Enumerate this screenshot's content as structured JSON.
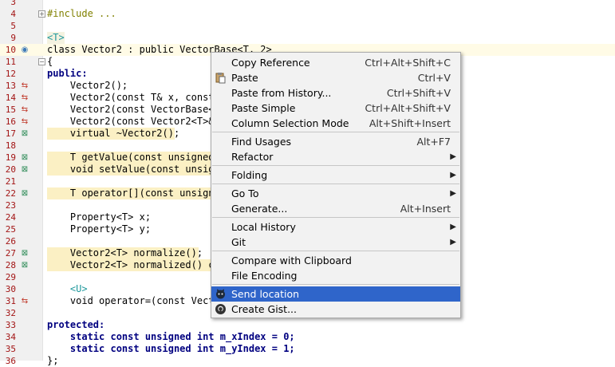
{
  "editor": {
    "lines": [
      {
        "num": "3"
      },
      {
        "num": "4",
        "code": "#include ..."
      },
      {
        "num": "5"
      },
      {
        "num": "9",
        "code": "<T>"
      },
      {
        "num": "10",
        "code": "class Vector2 : public VectorBase<T, 2>"
      },
      {
        "num": "11",
        "code": "{"
      },
      {
        "num": "12",
        "code": "public:"
      },
      {
        "num": "13",
        "code": "    Vector2();"
      },
      {
        "num": "14",
        "code": "    Vector2(const T& x, const"
      },
      {
        "num": "15",
        "code": "    Vector2(const VectorBase<T"
      },
      {
        "num": "16",
        "code": "    Vector2(const Vector2<T>&"
      },
      {
        "num": "17",
        "code": "    virtual ~Vector2();"
      },
      {
        "num": "18"
      },
      {
        "num": "19",
        "code": "    T getValue(const unsigned"
      },
      {
        "num": "20",
        "code": "    void setValue(const unsign"
      },
      {
        "num": "21"
      },
      {
        "num": "22",
        "code": "    T operator[](const unsigne"
      },
      {
        "num": "23"
      },
      {
        "num": "24",
        "code": "    Property<T> x;"
      },
      {
        "num": "25",
        "code": "    Property<T> y;"
      },
      {
        "num": "26"
      },
      {
        "num": "27",
        "code": "    Vector2<T> normalize();"
      },
      {
        "num": "28",
        "code": "    Vector2<T> normalized() co"
      },
      {
        "num": "29"
      },
      {
        "num": "30",
        "code": "    <U>"
      },
      {
        "num": "31",
        "code": "    void operator=(const Vecto"
      },
      {
        "num": "32"
      },
      {
        "num": "33",
        "code": "protected:"
      },
      {
        "num": "34",
        "code": "    static const unsigned int m_xIndex = 0;"
      },
      {
        "num": "35",
        "code": "    static const unsigned int m_yIndex = 1;"
      },
      {
        "num": "36",
        "code": "};"
      }
    ]
  },
  "menu": {
    "items": [
      {
        "label": "Copy Reference",
        "shortcut": "Ctrl+Alt+Shift+C"
      },
      {
        "label": "Paste",
        "shortcut": "Ctrl+V",
        "icon": "clipboard-paste-icon"
      },
      {
        "label": "Paste from History...",
        "shortcut": "Ctrl+Shift+V"
      },
      {
        "label": "Paste Simple",
        "shortcut": "Ctrl+Alt+Shift+V"
      },
      {
        "label": "Column Selection Mode",
        "shortcut": "Alt+Shift+Insert"
      },
      {
        "label": "Find Usages",
        "shortcut": "Alt+F7"
      },
      {
        "label": "Refactor",
        "submenu": true
      },
      {
        "label": "Folding",
        "submenu": true
      },
      {
        "label": "Go To",
        "submenu": true
      },
      {
        "label": "Generate...",
        "shortcut": "Alt+Insert"
      },
      {
        "label": "Local History",
        "submenu": true
      },
      {
        "label": "Git",
        "submenu": true
      },
      {
        "label": "Compare with Clipboard"
      },
      {
        "label": "File Encoding"
      },
      {
        "label": "Send location",
        "icon": "octocat-icon",
        "selected": true
      },
      {
        "label": "Create Gist...",
        "icon": "github-icon"
      }
    ]
  },
  "colors": {
    "menu_selection": "#2f65ca",
    "line_number": "#a31515",
    "keyword": "#000080"
  }
}
